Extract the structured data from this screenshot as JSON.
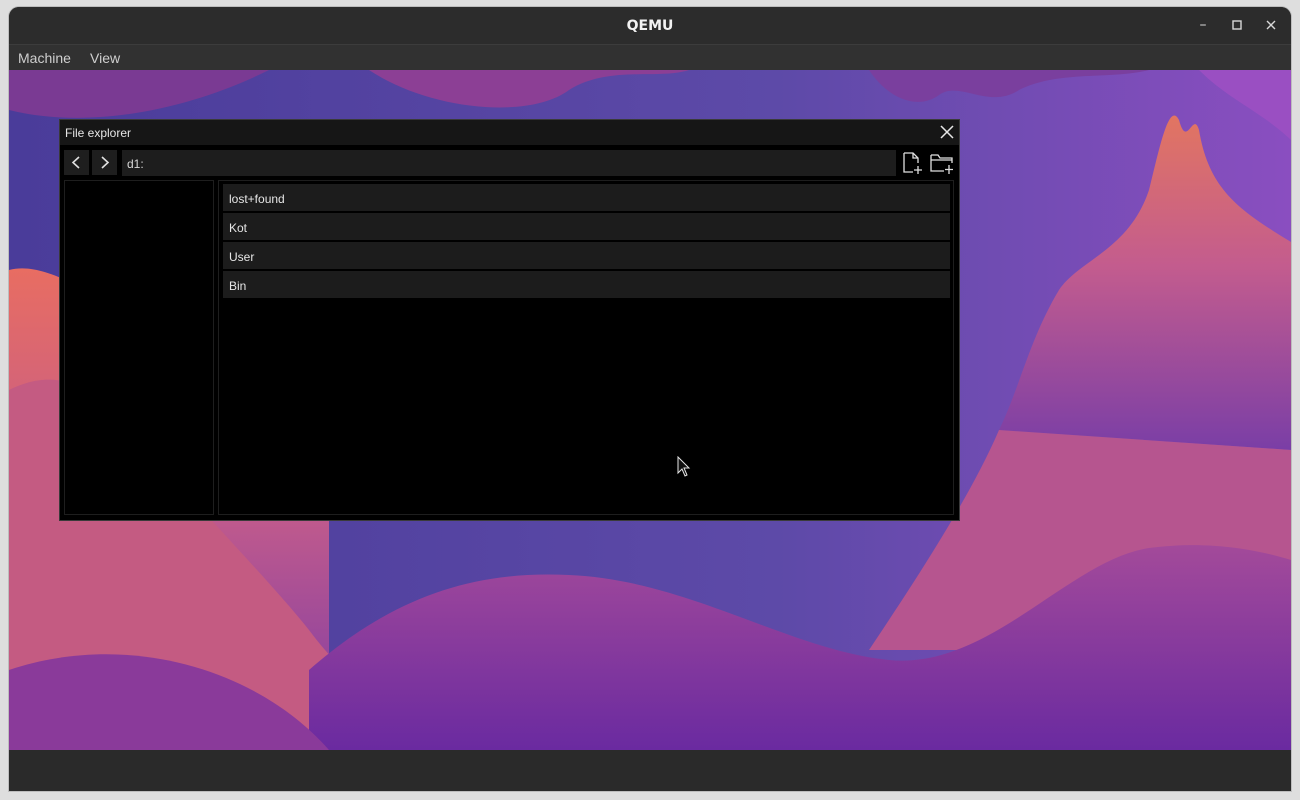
{
  "host": {
    "title": "QEMU",
    "controls": {
      "minimize_icon": "minimize-icon",
      "maximize_icon": "maximize-icon",
      "close_icon": "close-icon"
    },
    "menu": [
      {
        "label": "Machine"
      },
      {
        "label": "View"
      }
    ]
  },
  "explorer": {
    "title": "File explorer",
    "path": "d1:",
    "toolbar": {
      "back_icon": "chevron-left-icon",
      "forward_icon": "chevron-right-icon",
      "new_file_icon": "new-file-icon",
      "new_folder_icon": "new-folder-icon"
    },
    "entries": [
      {
        "name": "lost+found"
      },
      {
        "name": "Kot"
      },
      {
        "name": "User"
      },
      {
        "name": "Bin"
      }
    ]
  },
  "colors": {
    "host_chrome": "#2c2c2c",
    "wallpaper_purple": "#5a3e9a",
    "wallpaper_pink": "#d46a7a",
    "explorer_bg": "#000000",
    "row_bg": "#1c1c1c"
  }
}
